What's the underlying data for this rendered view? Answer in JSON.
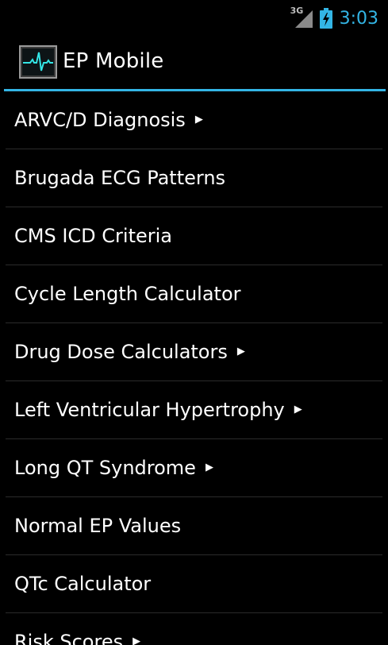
{
  "status_bar": {
    "network_type": "3G",
    "time": "3:03",
    "signal_icon": "signal-strength-icon",
    "battery_icon": "battery-charging-icon",
    "accent_color": "#33b5e5"
  },
  "action_bar": {
    "title": "EP Mobile",
    "app_icon": "ecg-waveform-icon",
    "divider_color": "#33b5e5"
  },
  "menu": {
    "items": [
      {
        "label": "ARVC/D Diagnosis",
        "submenu": "▶"
      },
      {
        "label": "Brugada ECG Patterns",
        "submenu": ""
      },
      {
        "label": "CMS ICD Criteria",
        "submenu": ""
      },
      {
        "label": "Cycle Length Calculator",
        "submenu": ""
      },
      {
        "label": "Drug Dose Calculators",
        "submenu": "▶"
      },
      {
        "label": "Left Ventricular Hypertrophy",
        "submenu": "▶"
      },
      {
        "label": "Long QT Syndrome",
        "submenu": "▶"
      },
      {
        "label": "Normal EP Values",
        "submenu": ""
      },
      {
        "label": "QTc Calculator",
        "submenu": ""
      },
      {
        "label": "Risk Scores",
        "submenu": "▶"
      }
    ]
  }
}
